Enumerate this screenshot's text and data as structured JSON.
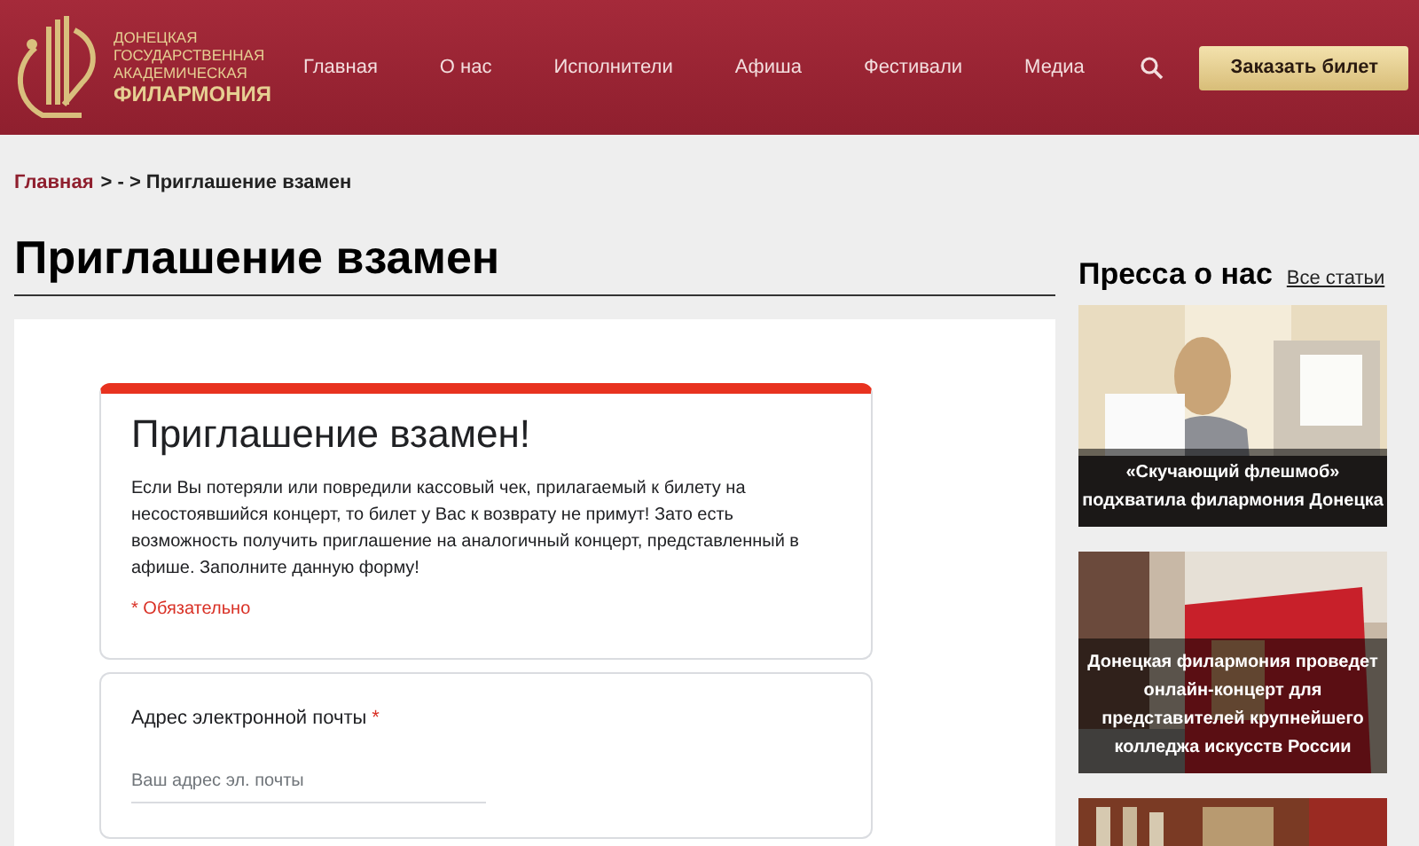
{
  "header": {
    "logo_lines": [
      "ДОНЕЦКАЯ",
      "ГОСУДАРСТВЕННАЯ",
      "АКАДЕМИЧЕСКАЯ"
    ],
    "logo_name": "ФИЛАРМОНИЯ",
    "nav": [
      "Главная",
      "О нас",
      "Исполнители",
      "Афиша",
      "Фестивали",
      "Медиа"
    ],
    "cta": "Заказать билет"
  },
  "breadcrumb": {
    "home": "Главная",
    "rest": "> - > Приглашение взамен"
  },
  "page_title": "Приглашение взамен",
  "form": {
    "title": "Приглашение взамен!",
    "description": "Если Вы потеряли или повредили кассовый чек, прилагаемый к билету на несостоявшийся концерт, то билет у Вас к возврату не примут! Зато есть возможность получить приглашение на аналогичный концерт, представленный в афише. Заполните данную форму!",
    "required_note": "* Обязательно",
    "questions": [
      {
        "label": "Адрес электронной почты",
        "required_mark": "*",
        "placeholder": "Ваш адрес эл. почты"
      }
    ]
  },
  "press": {
    "title": "Пресса о нас",
    "all_link": "Все статьи",
    "items": [
      {
        "caption": "«Скучающий флешмоб» подхватила филармония Донецка",
        "kind": "picture"
      },
      {
        "caption": "Донецкая филармония проведет онлайн-концерт для представителей крупнейшего колледжа искусств России",
        "kind": "picture"
      },
      {
        "kind": "picture"
      }
    ]
  }
}
